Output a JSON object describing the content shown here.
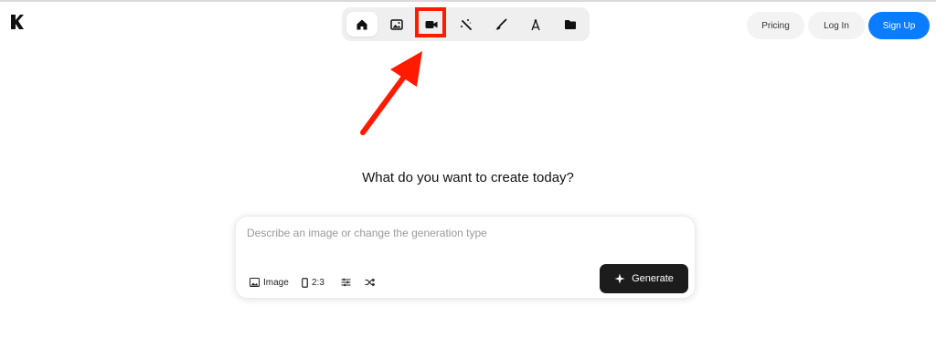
{
  "toolbar": {
    "tools": [
      {
        "icon": "home-icon",
        "active": true
      },
      {
        "icon": "image-icon",
        "active": false
      },
      {
        "icon": "video-camera-icon",
        "active": false
      },
      {
        "icon": "magic-wand-icon",
        "active": false
      },
      {
        "icon": "brush-icon",
        "active": false
      },
      {
        "icon": "compass-icon",
        "active": false
      },
      {
        "icon": "folder-icon",
        "active": false
      }
    ]
  },
  "header": {
    "pricing_label": "Pricing",
    "login_label": "Log In",
    "signup_label": "Sign Up"
  },
  "main": {
    "heading": "What do you want to create today?",
    "prompt": {
      "value": "",
      "placeholder": "Describe an image or change the generation type"
    },
    "options": {
      "type_label": "Image",
      "aspect_label": "2:3"
    },
    "generate_label": "Generate"
  },
  "annotation": {
    "highlight_color": "#ff1a00",
    "highlighted_tool": "video-camera-icon"
  },
  "colors": {
    "accent": "#0a7cff",
    "generate_bg": "#1c1c1c"
  }
}
